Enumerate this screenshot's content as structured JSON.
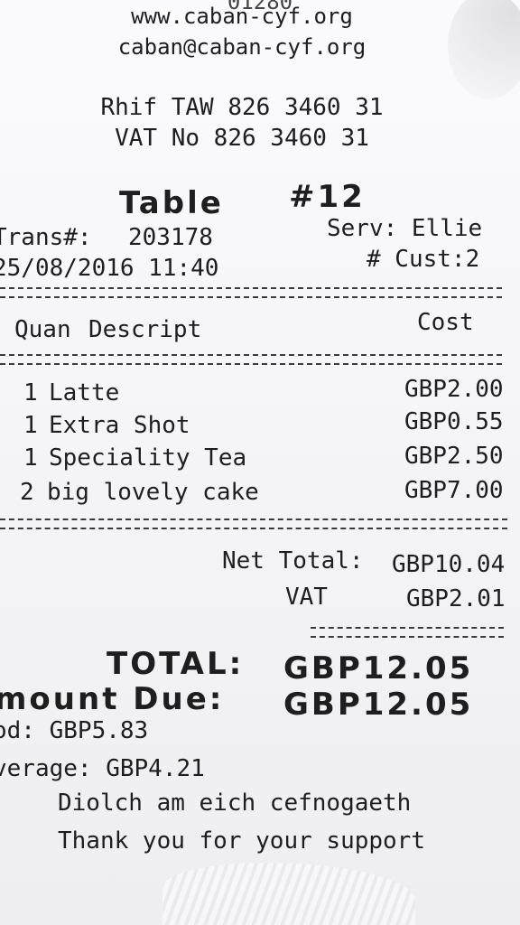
{
  "header": {
    "phone_partial": "01280",
    "website": "www.caban-cyf.org",
    "email": "caban@caban-cyf.org",
    "rhif": "Rhif TAW 826 3460 31",
    "vat_no": "VAT No 826 3460 31"
  },
  "order": {
    "table_label": "Table",
    "table_number": "#12",
    "trans_label": "Trans#:",
    "trans_value": "203178",
    "server": "Serv: Ellie",
    "datetime": "25/08/2016 11:40",
    "customers": "# Cust:2"
  },
  "columns": {
    "quan": "Quan",
    "desc": "Descript",
    "cost": "Cost"
  },
  "items": [
    {
      "qty": "1",
      "desc": "Latte",
      "cost": "GBP2.00"
    },
    {
      "qty": "1",
      "desc": "Extra Shot",
      "cost": "GBP0.55"
    },
    {
      "qty": "1",
      "desc": "Speciality Tea",
      "cost": "GBP2.50"
    },
    {
      "qty": "2",
      "desc": "big lovely cake",
      "cost": "GBP7.00"
    }
  ],
  "totals": {
    "net_label": "Net Total:",
    "net_value": "GBP10.04",
    "vat_label": "VAT",
    "vat_value": "GBP2.01",
    "total_label": "TOTAL:",
    "total_value": "GBP12.05",
    "due_label": "mount Due:",
    "due_value": "GBP12.05",
    "pd_line": "od: GBP5.83",
    "average_line": "verage: GBP4.21"
  },
  "footer": {
    "welsh": "Diolch am eich cefnogaeth",
    "english": "Thank you for your support"
  }
}
